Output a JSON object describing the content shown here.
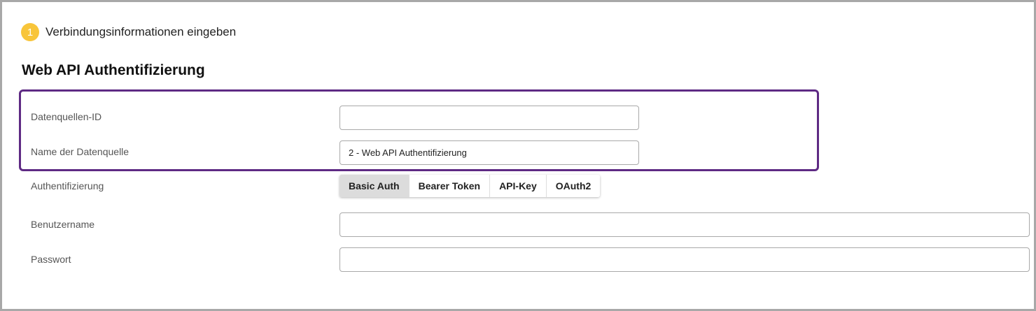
{
  "step": {
    "number": "1",
    "label": "Verbindungsinformationen eingeben"
  },
  "section": {
    "title": "Web API Authentifizierung"
  },
  "fields": {
    "datasource_id": {
      "label": "Datenquellen-ID",
      "value": ""
    },
    "datasource_name": {
      "label": "Name der Datenquelle",
      "value": "2 - Web API Authentifizierung"
    },
    "authentication": {
      "label": "Authentifizierung"
    },
    "username": {
      "label": "Benutzername",
      "value": ""
    },
    "password": {
      "label": "Passwort",
      "value": ""
    }
  },
  "auth_options": [
    {
      "label": "Basic Auth",
      "selected": true
    },
    {
      "label": "Bearer Token",
      "selected": false
    },
    {
      "label": "API-Key",
      "selected": false
    },
    {
      "label": "OAuth2",
      "selected": false
    }
  ],
  "colors": {
    "step_badge": "#f8c53a",
    "highlight_border": "#5e2a84",
    "selected_option": "#dcdcdc"
  }
}
